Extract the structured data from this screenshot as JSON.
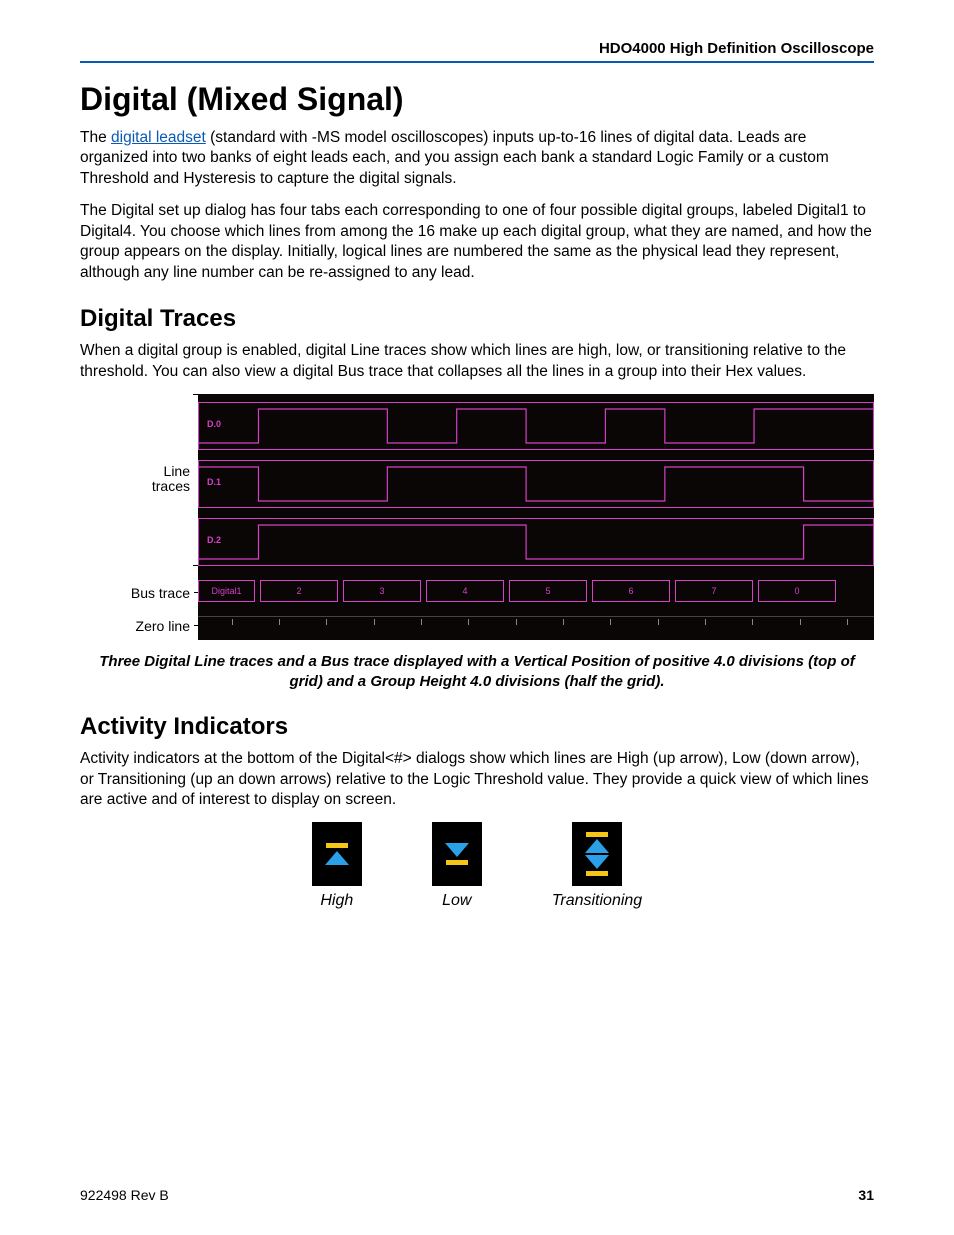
{
  "header": {
    "product": "HDO4000 High Definition Oscilloscope"
  },
  "h1": "Digital (Mixed Signal)",
  "intro": {
    "pre": "The ",
    "link": "digital leadset",
    "post": " (standard with -MS model oscilloscopes) inputs up-to-16 lines of digital data. Leads are organized into two banks of eight leads each, and you assign each bank a standard Logic Family or a custom Threshold and Hysteresis to capture the digital signals."
  },
  "intro2": "The Digital set up dialog has four tabs each corresponding to one of four possible digital groups, labeled Digital1 to Digital4. You choose which lines from among the 16 make up each digital group, what they are named, and how the group appears on the display. Initially, logical lines are numbered the same as the physical lead they represent, although any line number can be re-assigned to any lead.",
  "h2a": "Digital Traces",
  "traces_p": "When a digital group is enabled, digital Line traces show which lines are high, low, or transitioning relative to the threshold. You can also view a digital Bus trace that collapses all the lines in a group into their Hex values.",
  "trace_labels": {
    "line": "Line\ntraces",
    "bus": "Bus trace",
    "zero": "Zero line"
  },
  "lanes": [
    "D.0",
    "D.1",
    "D.2"
  ],
  "bus": {
    "label": "Digital1",
    "values": [
      "2",
      "3",
      "4",
      "5",
      "6",
      "7",
      "0"
    ]
  },
  "caption": "Three Digital Line traces and a Bus trace displayed with a Vertical Position of positive 4.0 divisions (top of grid) and a Group Height 4.0 divisions (half the grid).",
  "h2b": "Activity Indicators",
  "activity_p": "Activity indicators at the bottom of the Digital<#> dialogs show which lines are High (up arrow), Low (down arrow), or Transitioning (up an down arrows) relative to the Logic Threshold value. They provide a quick view of which lines are active and of interest to display on screen.",
  "indicators": {
    "high": "High",
    "low": "Low",
    "trans": "Transitioning"
  },
  "footer": {
    "rev": "922498 Rev B",
    "page": "31"
  }
}
